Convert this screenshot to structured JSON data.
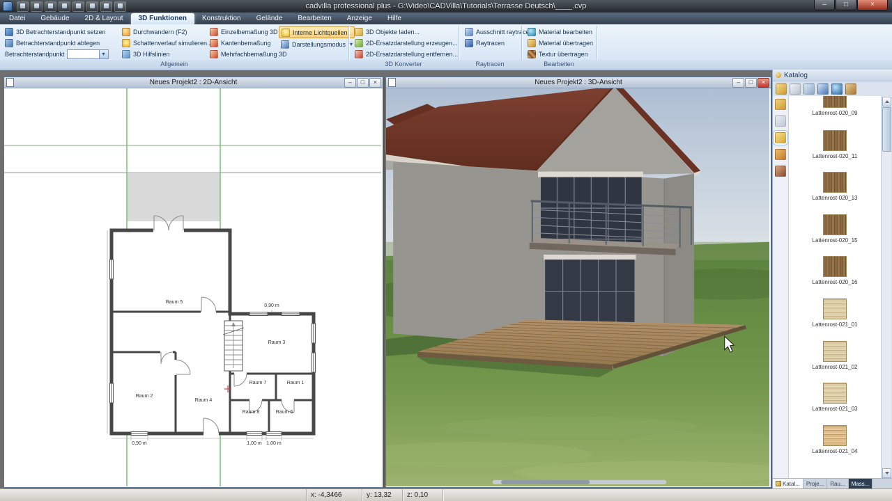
{
  "titlebar": {
    "title": "cadvilla professional plus - G:\\Video\\CADVilla\\Tutorials\\Terrasse Deutsch\\____.cvp"
  },
  "icons": {
    "minimize": "–",
    "maximize": "□",
    "close": "×",
    "dropdown": "▾"
  },
  "tabs": [
    "Datei",
    "Gebäude",
    "2D & Layout",
    "3D Funktionen",
    "Konstruktion",
    "Gelände",
    "Bearbeiten",
    "Anzeige",
    "Hilfe"
  ],
  "ribbon": {
    "grp_allgemein": "Allgemein",
    "grp_konverter": "3D Konverter",
    "grp_raytracen": "Raytracen",
    "grp_bearbeiten": "Bearbeiten",
    "btn_set_viewpoint": "3D Betrachterstandpunkt setzen",
    "btn_drop_viewpoint": "Betrachterstandpunkt ablegen",
    "lbl_viewpoint": "Betrachterstandpunkt",
    "btn_walk": "Durchwandern (F2)",
    "btn_shadow": "Schattenverlauf simulieren...",
    "btn_guides": "3D Hilfslinien",
    "btn_dim_single": "Einzelbemaßung 3D",
    "btn_dim_edge": "Kantenbemaßung",
    "btn_dim_multi": "Mehrfachbemaßung 3D",
    "btn_lights": "Interne Lichtquellen",
    "btn_display_mode": "Darstellungsmodus",
    "btn_load_3d": "3D Objekte laden...",
    "btn_2d_create": "2D-Ersatzdarstellung erzeugen...",
    "btn_2d_remove": "2D-Ersatzdarstellung entfernen...",
    "btn_raytrace_crop": "Ausschnitt raytracen",
    "btn_raytrace": "Raytracen",
    "btn_mat_edit": "Material bearbeiten",
    "btn_mat_transfer": "Material übertragen",
    "btn_tex_transfer": "Textur übertragen"
  },
  "plan": {
    "window_title": "Neues Projekt2 : 2D-Ansicht",
    "rooms": [
      "Raum 5",
      "Raum 3",
      "Raum 7",
      "Raum 1",
      "Raum 2",
      "Raum 4",
      "Raum 8",
      "Raum 6"
    ],
    "dims": [
      "0,90 m",
      "0,90 m",
      "1,00 m",
      "1,00 m"
    ]
  },
  "view3d": {
    "window_title": "Neues Projekt2 : 3D-Ansicht"
  },
  "catalog": {
    "title": "Katalog",
    "items": [
      {
        "label": "Lattenrost-020_09",
        "tex": "wood-v"
      },
      {
        "label": "Lattenrost-020_11",
        "tex": "wood-v"
      },
      {
        "label": "Lattenrost-020_13",
        "tex": "wood-v"
      },
      {
        "label": "Lattenrost-020_15",
        "tex": "wood-v"
      },
      {
        "label": "Lattenrost-020_16",
        "tex": "wood-v"
      },
      {
        "label": "Lattenrost-021_01",
        "tex": "wood-h"
      },
      {
        "label": "Lattenrost-021_02",
        "tex": "wood-h"
      },
      {
        "label": "Lattenrost-021_03",
        "tex": "wood-h"
      },
      {
        "label": "Lattenrost-021_04",
        "tex": "wood-h-warm"
      }
    ],
    "tabs": [
      "Katal...",
      "Proje...",
      "Rau...",
      "Mass..."
    ]
  },
  "statusbar": {
    "x": "x: -4,3466",
    "y": "y: 13,32",
    "z": "z: 0,10"
  }
}
